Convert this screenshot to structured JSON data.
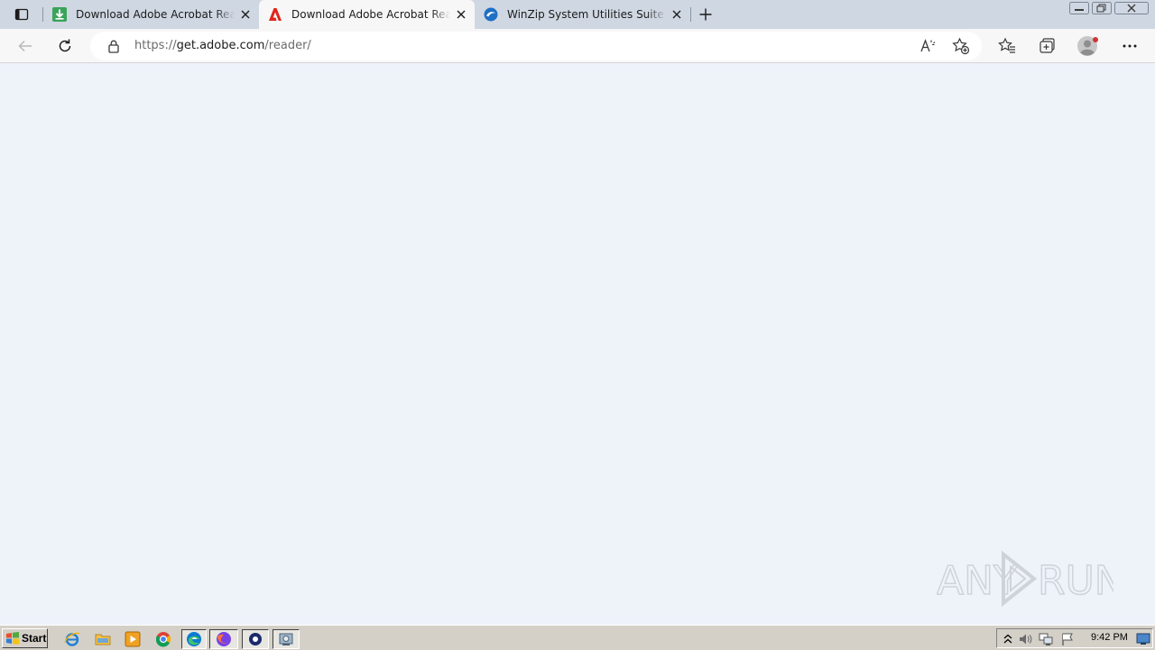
{
  "browser": {
    "tabs": [
      {
        "title": "Download Adobe Acrobat Reader",
        "favicon": "download-arrow-icon",
        "active": false
      },
      {
        "title": "Download Adobe Acrobat Reader",
        "favicon": "adobe-icon",
        "active": true
      },
      {
        "title": "WinZip System Utilities Suite - Your",
        "favicon": "winzip-icon",
        "active": false
      }
    ],
    "address": {
      "scheme": "https://",
      "host": "get.adobe.com",
      "path": "/reader/"
    }
  },
  "watermark": {
    "text": "ANY",
    "text2": "RUN"
  },
  "taskbar": {
    "start_label": "Start",
    "quick_launch": [
      "ie-icon",
      "folder-icon",
      "media-player-icon",
      "chrome-icon",
      "edge-icon",
      "firefox-icon",
      "opera-icon",
      "app-icon"
    ],
    "clock": "9:42 PM"
  },
  "colors": {
    "tabstrip": "#cfd7e2",
    "toolbar": "#f7f7f7",
    "content": "#eef3fa",
    "taskbar": "#d4d0c8",
    "adobe_red": "#e1251b",
    "download_green": "#3aa35a"
  }
}
